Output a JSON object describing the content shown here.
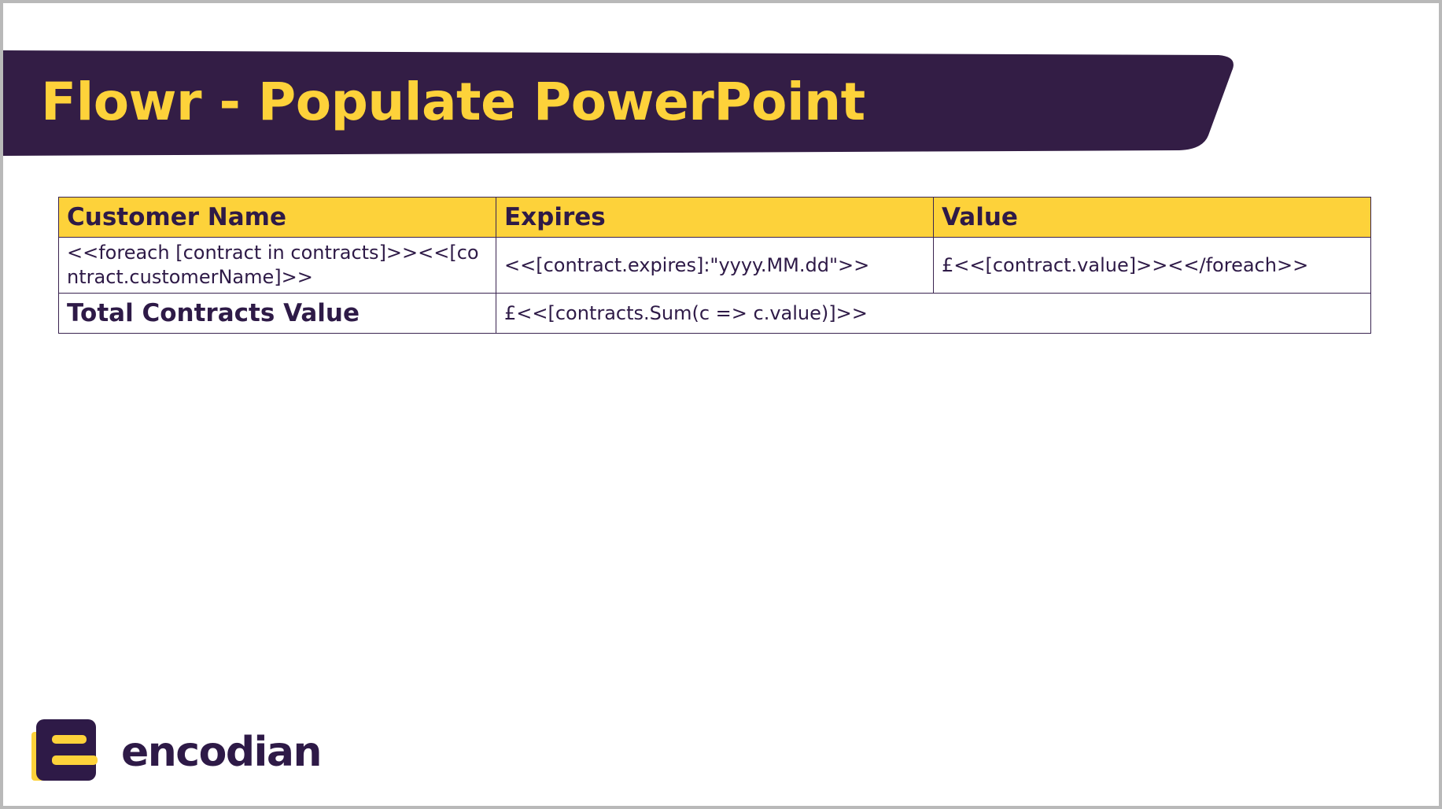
{
  "slide": {
    "title": "Flowr - Populate PowerPoint"
  },
  "table": {
    "headers": [
      "Customer Name",
      "Expires",
      "Value"
    ],
    "row": {
      "customer_name": "<<foreach [contract in contracts]>><<[contract.customerName]>>",
      "expires": "<<[contract.expires]:\"yyyy.MM.dd\">>",
      "value": "£<<[contract.value]>><</foreach>>"
    },
    "total": {
      "label": "Total Contracts Value",
      "value": "£<<[contracts.Sum(c => c.value)]>>"
    }
  },
  "brand": {
    "name": "encodian",
    "primary_color": "#2e1a47",
    "accent_color": "#fdd23a",
    "logo_icon": "encodian-e-icon"
  }
}
